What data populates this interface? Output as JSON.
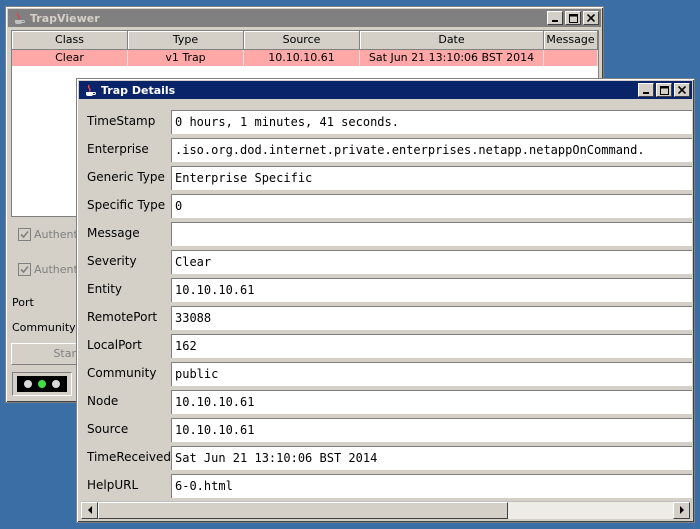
{
  "trapviewer": {
    "title": "TrapViewer",
    "columns": [
      "Class",
      "Type",
      "Source",
      "Date",
      "Message"
    ],
    "rows": [
      {
        "class": "Clear",
        "type": "v1 Trap",
        "source": "10.10.10.61",
        "date": "Sat Jun 21 13:10:06 BST 2014",
        "message": ""
      }
    ],
    "row_highlight_color": "#ffa8a8",
    "auth_checkbox_1_label": "Authent",
    "auth_checkbox_2_label": "Authent",
    "port_label": "Port",
    "community_label": "Community",
    "start_button_label": "Star",
    "leds": [
      "#d8d8d8",
      "#44dd44",
      "#d8d8d8"
    ]
  },
  "details": {
    "title": "Trap Details",
    "fields": [
      {
        "label": "TimeStamp",
        "value": "0 hours, 1 minutes, 41 seconds."
      },
      {
        "label": "Enterprise",
        "value": ".iso.org.dod.internet.private.enterprises.netapp.netappOnCommand."
      },
      {
        "label": "Generic Type",
        "value": "Enterprise Specific"
      },
      {
        "label": "Specific Type",
        "value": "0"
      },
      {
        "label": "Message",
        "value": ""
      },
      {
        "label": "Severity",
        "value": "Clear"
      },
      {
        "label": "Entity",
        "value": "10.10.10.61"
      },
      {
        "label": "RemotePort",
        "value": "33088"
      },
      {
        "label": "LocalPort",
        "value": "162"
      },
      {
        "label": "Community",
        "value": "public"
      },
      {
        "label": "Node",
        "value": "10.10.10.61"
      },
      {
        "label": "Source",
        "value": "10.10.10.61"
      },
      {
        "label": "TimeReceived",
        "value": "Sat Jun 21 13:10:06 BST 2014"
      },
      {
        "label": "HelpURL",
        "value": "6-0.html"
      }
    ]
  },
  "colors": {
    "desktop": "#3a6ea5",
    "active_title": "#0a246a",
    "inactive_title": "#808080"
  }
}
